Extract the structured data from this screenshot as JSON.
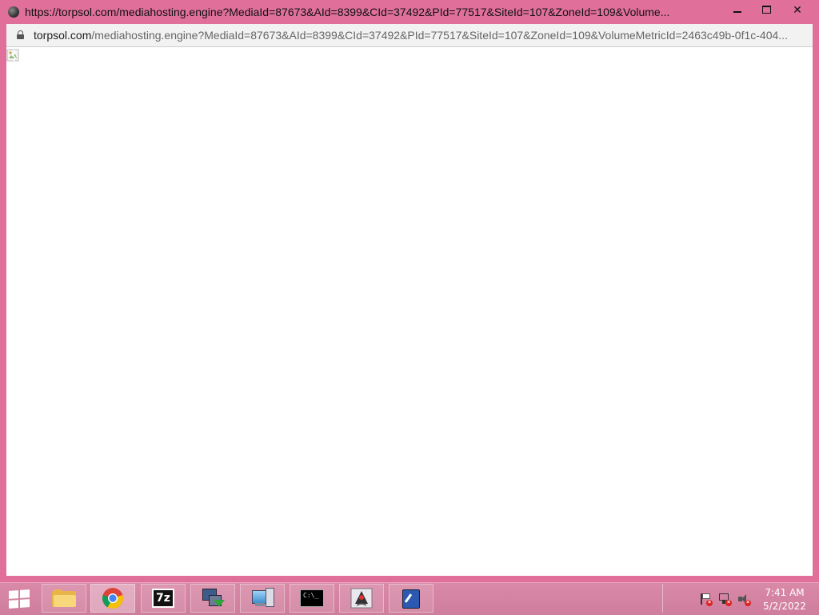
{
  "window": {
    "title": "https://torpsol.com/mediahosting.engine?MediaId=87673&AId=8399&CId=37492&PId=77517&SiteId=107&ZoneId=109&Volume...",
    "close_symbol": "✕"
  },
  "address_bar": {
    "host": "torpsol.com",
    "path": "/mediahosting.engine?MediaId=87673&AId=8399&CId=37492&PId=77517&SiteId=107&ZoneId=109&VolumeMetricId=2463c49b-0f1c-404..."
  },
  "taskbar": {
    "apps": [
      {
        "name": "file-explorer",
        "icon": "folder-icon"
      },
      {
        "name": "google-chrome",
        "icon": "chrome-icon",
        "active": true
      },
      {
        "name": "7-zip",
        "icon": "7zip-icon",
        "label": "7z"
      },
      {
        "name": "remote-connection",
        "icon": "remote-desktop-icon"
      },
      {
        "name": "computer",
        "icon": "computer-icon"
      },
      {
        "name": "command-prompt",
        "icon": "cmd-icon",
        "label": "C:\\_"
      },
      {
        "name": "java-app",
        "icon": "java-icon"
      },
      {
        "name": "certificate-manager",
        "icon": "certificate-icon"
      }
    ]
  },
  "clock": {
    "time": "7:41 AM",
    "date": "5/2/2022"
  },
  "colors": {
    "window_frame": "#e0709a",
    "taskbar": "#d3829f",
    "content_background": "#ffffff"
  }
}
